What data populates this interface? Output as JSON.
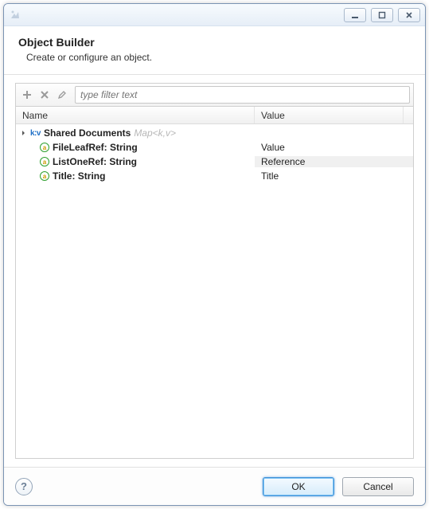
{
  "header": {
    "title": "Object Builder",
    "subtitle": "Create or configure an object."
  },
  "toolbar": {
    "filter_placeholder": "type filter text"
  },
  "table": {
    "columns": {
      "name": "Name",
      "value": "Value"
    },
    "root": {
      "label": "Shared Documents",
      "type_hint": "Map<k,v>"
    },
    "rows": [
      {
        "name": "FileLeafRef: String",
        "value": "Value",
        "selected": false
      },
      {
        "name": "ListOneRef: String",
        "value": "Reference",
        "selected": true
      },
      {
        "name": "Title: String",
        "value": "Title",
        "selected": false
      }
    ]
  },
  "footer": {
    "ok": "OK",
    "cancel": "Cancel"
  },
  "icons": {
    "kv": "k:v",
    "attr": "a",
    "help": "?"
  }
}
